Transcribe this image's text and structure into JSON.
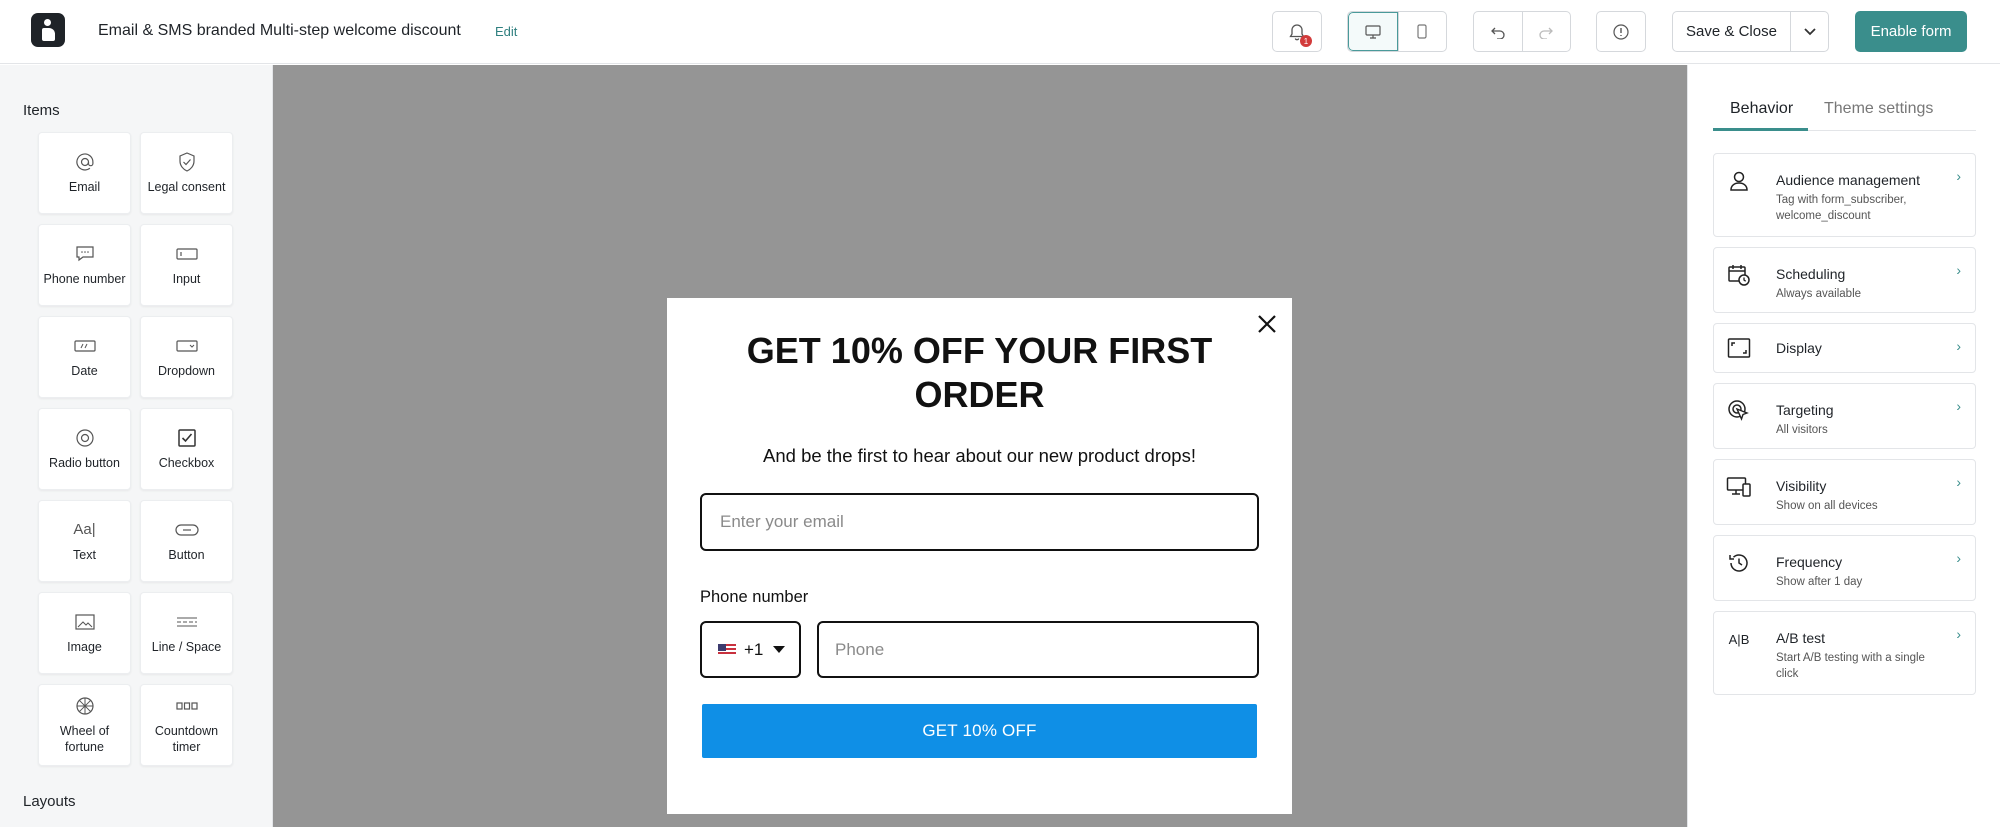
{
  "header": {
    "title": "Email & SMS branded Multi-step welcome discount",
    "edit_label": "Edit",
    "notification_count": "1",
    "save_label": "Save & Close",
    "enable_label": "Enable form"
  },
  "sidebar": {
    "items_title": "Items",
    "layouts_title": "Layouts",
    "items": [
      {
        "label": "Email",
        "icon": "at-icon"
      },
      {
        "label": "Legal consent",
        "icon": "shield-check-icon"
      },
      {
        "label": "Phone number",
        "icon": "message-icon"
      },
      {
        "label": "Input",
        "icon": "input-icon"
      },
      {
        "label": "Date",
        "icon": "date-icon"
      },
      {
        "label": "Dropdown",
        "icon": "dropdown-icon"
      },
      {
        "label": "Radio button",
        "icon": "radio-icon"
      },
      {
        "label": "Checkbox",
        "icon": "checkbox-icon"
      },
      {
        "label": "Text",
        "icon": "text-icon"
      },
      {
        "label": "Button",
        "icon": "button-icon"
      },
      {
        "label": "Image",
        "icon": "image-icon"
      },
      {
        "label": "Line / Space",
        "icon": "line-space-icon"
      },
      {
        "label": "Wheel of fortune",
        "icon": "wheel-icon"
      },
      {
        "label": "Countdown timer",
        "icon": "countdown-icon"
      }
    ]
  },
  "popup": {
    "title": "GET 10% OFF YOUR FIRST ORDER",
    "subtitle": "And be the first to hear about our new product drops!",
    "email_placeholder": "Enter your email",
    "phone_label": "Phone number",
    "country_code": "+1",
    "phone_placeholder": "Phone",
    "cta_label": "GET 10% OFF",
    "cta_color": "#0f8fe6"
  },
  "panel": {
    "tabs": [
      "Behavior",
      "Theme settings"
    ],
    "cards": [
      {
        "title": "Audience management",
        "desc": "Tag with form_subscriber, welcome_discount",
        "icon": "person-icon"
      },
      {
        "title": "Scheduling",
        "desc": "Always available",
        "icon": "calendar-clock-icon"
      },
      {
        "title": "Display",
        "desc": "",
        "icon": "display-icon"
      },
      {
        "title": "Targeting",
        "desc": "All visitors",
        "icon": "target-icon"
      },
      {
        "title": "Visibility",
        "desc": "Show on all devices",
        "icon": "devices-icon"
      },
      {
        "title": "Frequency",
        "desc": "Show after 1 day",
        "icon": "history-icon"
      },
      {
        "title": "A/B test",
        "desc": "Start A/B testing with a single click",
        "icon": "ab-test-icon"
      }
    ]
  },
  "colors": {
    "accent": "#3a8e8c",
    "canvas_bg": "#959595"
  }
}
